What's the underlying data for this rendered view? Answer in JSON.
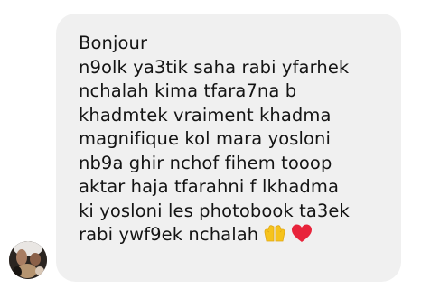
{
  "message": {
    "lines": [
      "Bonjour",
      "n9olk ya3tik saha rabi yfarhek",
      "nchalah kima tfara7na b",
      "khadmtek vraiment khadma",
      "magnifique kol mara yosloni",
      "nb9a ghir nchof fihem tooop",
      "aktar haja tfarahni f lkhadma",
      "ki yosloni les photobook ta3ek",
      "rabi ywf9ek  nchalah"
    ],
    "emojis": [
      "hands-icon",
      "red-heart-icon"
    ]
  },
  "colors": {
    "bubble": "#f0f0f0",
    "text": "#141414",
    "background": "#ffffff"
  }
}
